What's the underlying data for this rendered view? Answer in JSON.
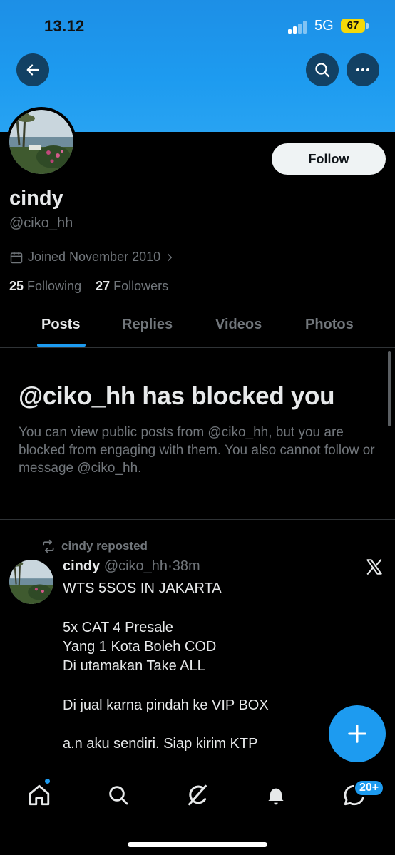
{
  "status_bar": {
    "time": "13.12",
    "network": "5G",
    "battery": "67"
  },
  "profile": {
    "name": "cindy",
    "handle": "@ciko_hh",
    "joined": "Joined November 2010",
    "following_count": "25",
    "following_label": "Following",
    "followers_count": "27",
    "followers_label": "Followers",
    "follow_label": "Follow"
  },
  "tabs": [
    {
      "label": "Posts",
      "active": true
    },
    {
      "label": "Replies",
      "active": false
    },
    {
      "label": "Videos",
      "active": false
    },
    {
      "label": "Photos",
      "active": false
    }
  ],
  "blocked": {
    "title": "@ciko_hh has blocked you",
    "message": "You can view public posts from @ciko_hh, but you are blocked from engaging with them. You also cannot follow or message @ciko_hh."
  },
  "post": {
    "repost_label": "cindy reposted",
    "author": "cindy",
    "handle": "@ciko_hh",
    "separator": "·",
    "time": "38m",
    "lines": [
      "WTS 5SOS IN JAKARTA",
      "",
      "5x CAT 4 Presale",
      "Yang 1 Kota Boleh COD",
      "Di utamakan Take ALL",
      "",
      "Di jual karna pindah ke VIP BOX",
      "",
      "a.n  aku sendiri. Siap kirim KTP"
    ]
  },
  "bottom_nav": {
    "items": [
      "home-icon",
      "search-icon",
      "grok-icon",
      "notifications-icon",
      "messages-icon"
    ],
    "messages_badge": "20+"
  },
  "icons": {
    "back": "arrow-left-icon",
    "search": "search-icon",
    "more": "more-icon",
    "calendar": "calendar-icon",
    "repost": "repost-icon",
    "x_logo": "x-logo-icon",
    "compose": "plus-icon"
  },
  "colors": {
    "accent": "#1d9bf0",
    "banner": "#1d9bf0",
    "background": "#000000",
    "text_primary": "#e7e9ea",
    "text_secondary": "#71767b",
    "battery": "#f5d90a"
  }
}
